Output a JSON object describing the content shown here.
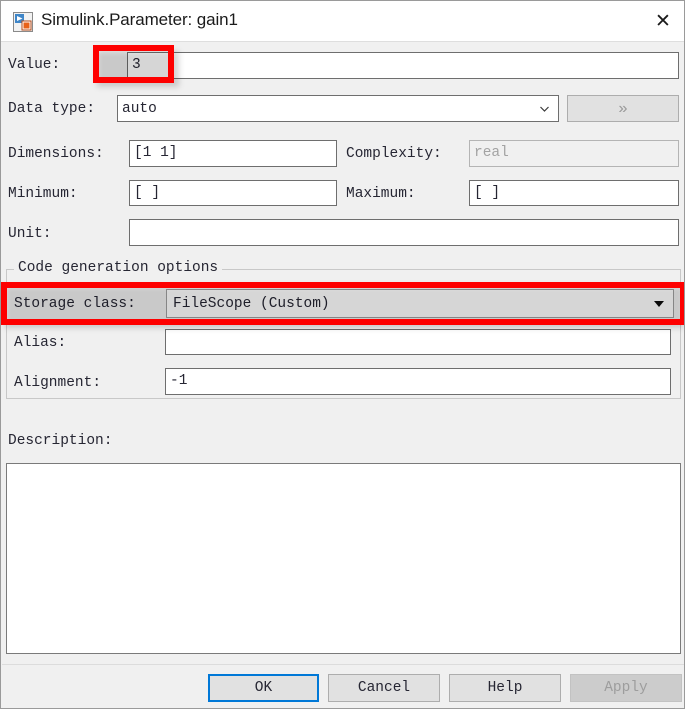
{
  "window": {
    "title": "Simulink.Parameter: gain1",
    "icon": "simulink-block-icon",
    "close_label": "✕"
  },
  "fields": {
    "value": {
      "label": "Value:",
      "value": "3"
    },
    "data_type": {
      "label": "Data type:",
      "value": "auto",
      "expand_button_label": "»"
    },
    "dimensions": {
      "label": "Dimensions:",
      "value": "[1 1]"
    },
    "complexity": {
      "label": "Complexity:",
      "value": "real",
      "disabled": true
    },
    "minimum": {
      "label": "Minimum:",
      "value": "[ ]"
    },
    "maximum": {
      "label": "Maximum:",
      "value": "[ ]"
    },
    "unit": {
      "label": "Unit:",
      "value": ""
    },
    "description": {
      "label": "Description:",
      "value": ""
    }
  },
  "code_generation": {
    "group_title": "Code generation options",
    "storage_class": {
      "label": "Storage class:",
      "value": "FileScope (Custom)"
    },
    "alias": {
      "label": "Alias:",
      "value": ""
    },
    "alignment": {
      "label": "Alignment:",
      "value": "-1"
    }
  },
  "buttons": {
    "ok": "OK",
    "cancel": "Cancel",
    "help": "Help",
    "apply": "Apply"
  },
  "annotations": [
    {
      "name": "value-field-highlight",
      "color": "#fe0000"
    },
    {
      "name": "storage-class-highlight",
      "color": "#fe0000"
    }
  ],
  "colors": {
    "accent_default_button": "#0078d7",
    "annotation": "#fe0000",
    "dialog_background": "#f0f0f0",
    "field_background": "#ffffff",
    "disabled_text": "#a3a3a3"
  }
}
